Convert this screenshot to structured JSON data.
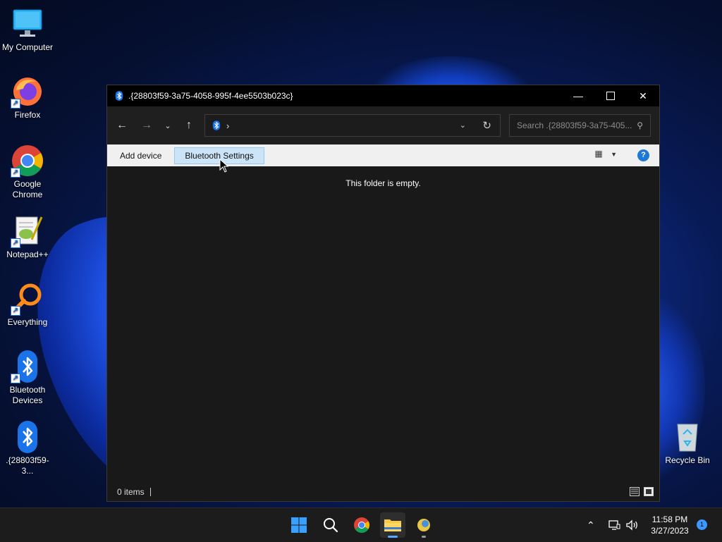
{
  "desktop": {
    "icons": [
      {
        "label": "My Computer"
      },
      {
        "label": "Firefox"
      },
      {
        "label": "Google Chrome"
      },
      {
        "label": "Notepad++"
      },
      {
        "label": "Everything"
      },
      {
        "label": "Bluetooth Devices"
      },
      {
        "label": ".{28803f59-3..."
      },
      {
        "label": "Recycle Bin"
      }
    ]
  },
  "window": {
    "title": ".{28803f59-3a75-4058-995f-4ee5503b023c}",
    "search_placeholder": "Search .{28803f59-3a75-405...",
    "address_separator": "›",
    "commands": {
      "add_device": "Add device",
      "bluetooth_settings": "Bluetooth Settings"
    },
    "empty_message": "This folder is empty.",
    "status_count": "0 items"
  },
  "taskbar": {
    "time": "11:58 PM",
    "date": "3/27/2023",
    "notification_count": "1"
  },
  "colors": {
    "accent": "#1e78d6",
    "bluetooth": "#1a73e8",
    "command_bar": "#f0f0f0",
    "window_bg": "#191919"
  }
}
